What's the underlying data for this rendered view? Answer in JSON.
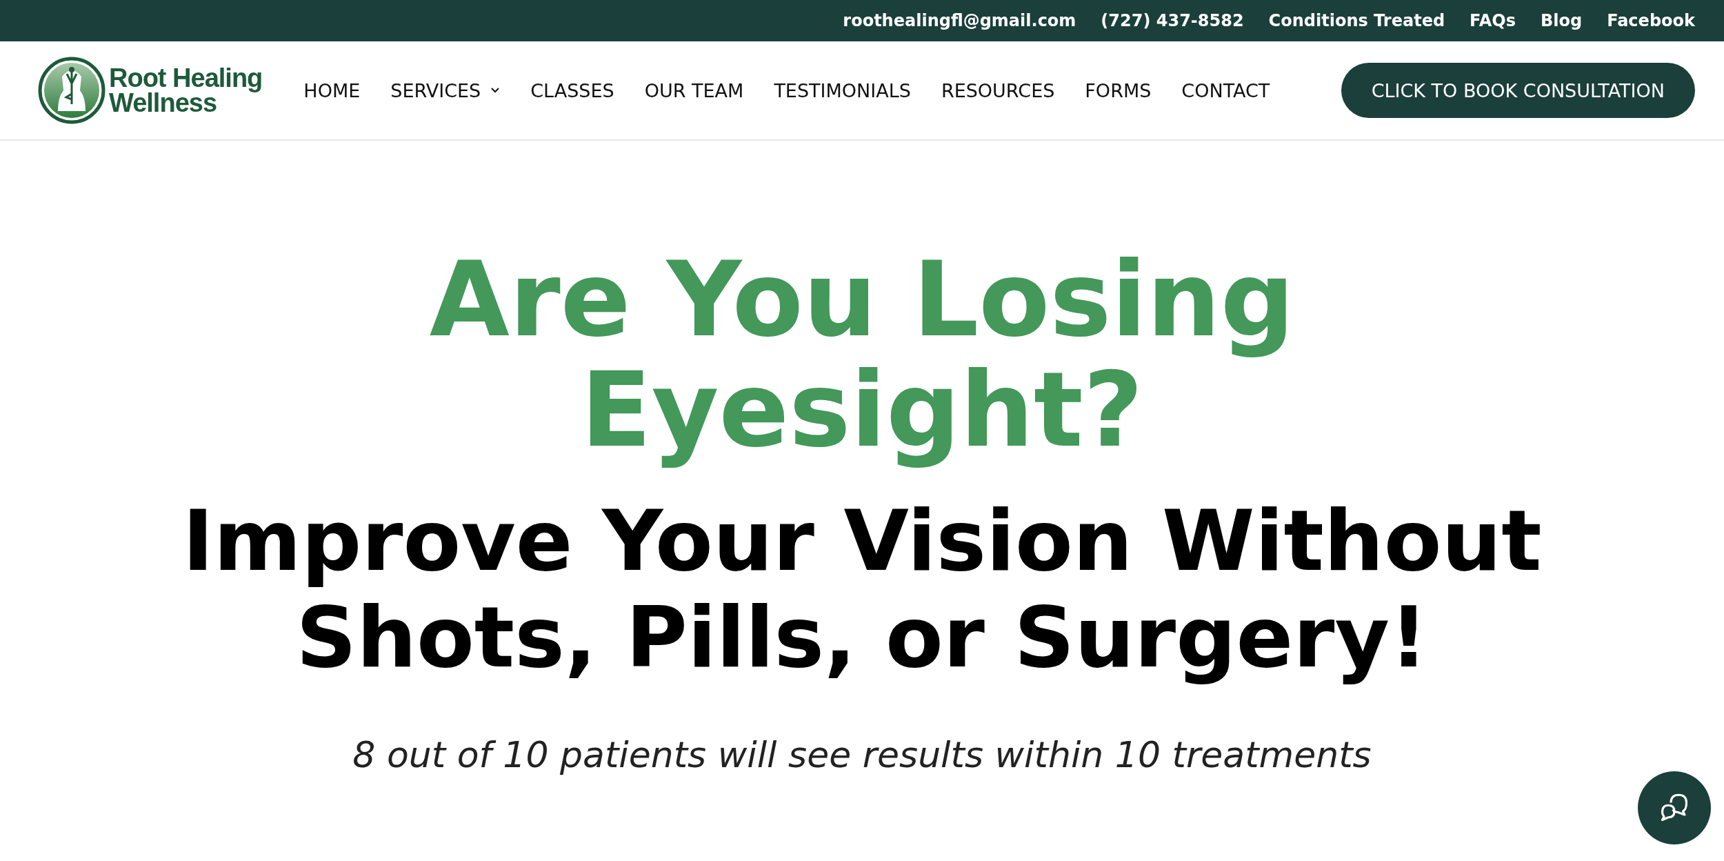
{
  "top_bar": {
    "links": [
      "roothealingfl@gmail.com",
      "(727) 437-8582",
      "Conditions Treated",
      "FAQs",
      "Blog",
      "Facebook"
    ]
  },
  "logo": {
    "lines": [
      "Root Healing",
      "Wellness"
    ]
  },
  "nav": {
    "items": [
      {
        "label": "HOME",
        "dropdown": false
      },
      {
        "label": "SERVICES",
        "dropdown": true
      },
      {
        "label": "CLASSES",
        "dropdown": false
      },
      {
        "label": "OUR TEAM",
        "dropdown": false
      },
      {
        "label": "TESTIMONIALS",
        "dropdown": false
      },
      {
        "label": "RESOURCES",
        "dropdown": false
      },
      {
        "label": "FORMS",
        "dropdown": false
      },
      {
        "label": "CONTACT",
        "dropdown": false
      }
    ],
    "cta": "CLICK TO BOOK CONSULTATION"
  },
  "hero": {
    "question": "Are You Losing Eyesight?",
    "headline": "Improve Your Vision Without Shots, Pills, or Surgery!",
    "subtitle": "8 out of 10 patients will see results within 10 treatments"
  }
}
